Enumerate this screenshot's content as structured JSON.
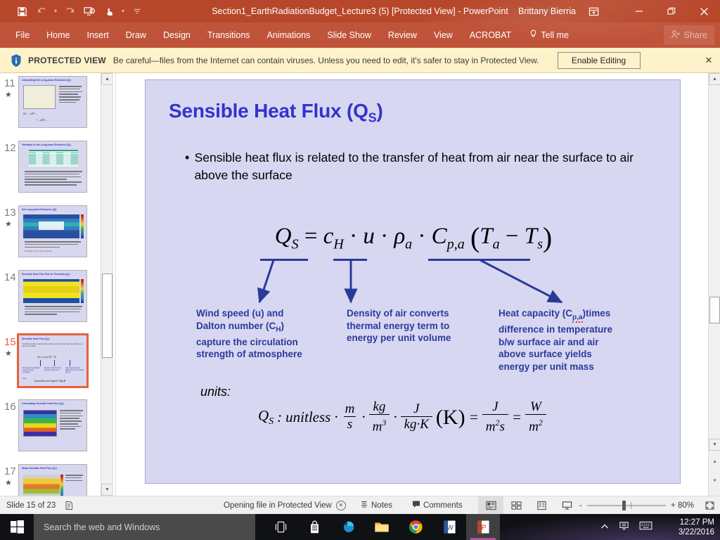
{
  "titlebar": {
    "document_title": "Section1_EarthRadiationBudget_Lecture3 (5) [Protected View] - PowerPoint",
    "user_name": "Brittany Bierria",
    "qat": [
      {
        "name": "save-icon",
        "label": "Save"
      },
      {
        "name": "undo-icon",
        "label": "Undo"
      },
      {
        "name": "redo-icon",
        "label": "Redo"
      },
      {
        "name": "start-from-beginning-icon",
        "label": "Start From Beginning"
      },
      {
        "name": "touch-mouse-mode-icon",
        "label": "Touch/Mouse Mode"
      },
      {
        "name": "customize-quick-access-toolbar-icon",
        "label": "Customize Quick Access Toolbar"
      }
    ],
    "window_controls": [
      {
        "name": "ribbon-display-options-icon",
        "glyph": "⤒"
      },
      {
        "name": "minimize-button",
        "glyph": "—"
      },
      {
        "name": "restore-button",
        "glyph": "❐"
      },
      {
        "name": "close-button",
        "glyph": "✕"
      }
    ]
  },
  "ribbon": {
    "tabs": [
      "File",
      "Home",
      "Insert",
      "Draw",
      "Design",
      "Transitions",
      "Animations",
      "Slide Show",
      "Review",
      "View",
      "ACROBAT"
    ],
    "tell_me": "Tell me",
    "share": "Share"
  },
  "protected_view": {
    "label": "PROTECTED VIEW",
    "message": "Be careful—files from the Internet can contain viruses. Unless you need to edit, it's safer to stay in Protected View.",
    "button": "Enable Editing",
    "close": "✕",
    "bar_color": "#fdf2ca"
  },
  "thumbnails": [
    {
      "number": "11",
      "title": "Calculating Net Long-wave Emission (Qₗ)",
      "starred": true,
      "selected": false,
      "kind": "chart"
    },
    {
      "number": "12",
      "title": "Variation in Net Long-wave Emission (Qₗ)",
      "starred": false,
      "selected": false,
      "kind": "table"
    },
    {
      "number": "13",
      "title": "Net Long-wave Emission (Qₗ)",
      "starred": true,
      "selected": false,
      "kind": "map-blue"
    },
    {
      "number": "14",
      "title": "Sensible Heat Flux Due to Thermals (Qₛ)",
      "starred": false,
      "selected": false,
      "kind": "map-yellow"
    },
    {
      "number": "15",
      "title": "Sensible Heat Flux (Qₛ)",
      "starred": true,
      "selected": true,
      "kind": "equation"
    },
    {
      "number": "16",
      "title": "Calculating Sensible Heat Flux (Qₛ)",
      "starred": false,
      "selected": false,
      "kind": "map-rainbow"
    },
    {
      "number": "17",
      "title": "Mean Sensible Heat Flux (Qₛ)",
      "starred": true,
      "selected": false,
      "kind": "map-grey"
    }
  ],
  "slide": {
    "background_color": "#d7d7f2",
    "title_color": "#3333cc",
    "title_main": "Sensible Heat Flux (Q",
    "title_sub": "S",
    "title_close": ")",
    "bullet": "Sensible heat flux is related to the transfer of heat from air near the surface to air above the surface",
    "equation": {
      "lhs": "Q",
      "lhs_sub": "S",
      "eq": " = ",
      "terms": "cₕ · u · ρₐ · Cₚ,ₐ (Tₐ − Tₛ)",
      "parts": {
        "c": "c",
        "c_sub": "H",
        "u": "u",
        "rho": "ρ",
        "rho_sub": "a",
        "C": "C",
        "C_sub": "p,a",
        "Ta": "T",
        "Ta_sub": "a",
        "Ts": "T",
        "Ts_sub": "s",
        "minus": "−",
        "dot": "·"
      }
    },
    "annotations": [
      {
        "id": "wind-speed-annotation",
        "line1": "Wind speed (u) and",
        "line2": "Dalton number (C",
        "line2_sub": "H",
        "line2_end": ")",
        "line3": "capture the circulation",
        "line4": "strength of atmosphere"
      },
      {
        "id": "density-annotation",
        "line1": "Density of air converts",
        "line2": "thermal energy term to",
        "line3": "energy per unit volume"
      },
      {
        "id": "heat-capacity-annotation",
        "line1_a": "Heat capacity (C",
        "line1_sub": "p,a",
        "line1_b": ")times",
        "line2": "difference in temperature",
        "line3": "b/w surface air and air",
        "line4": "above surface yields",
        "line5": "energy per unit mass"
      }
    ],
    "units_label": "units:",
    "units_equation": {
      "lhs": "Q",
      "lhs_sub": "S",
      "colon": " : ",
      "unitless": "unitless",
      "dot": "·",
      "f1_num": "m",
      "f1_den": "s",
      "f2_num": "kg",
      "f2_den": "m",
      "f2_den_sup": "3",
      "f3_num": "J",
      "f3_den": "kg·K",
      "kelvin": "(K)",
      "equals": "=",
      "f4_num": "J",
      "f4_den_a": "m",
      "f4_den_sup": "2",
      "f4_den_b": "s",
      "equals2": "=",
      "f5_num": "W",
      "f5_den": "m",
      "f5_den_sup": "2"
    },
    "annotation_color": "#2b3a99"
  },
  "statusbar": {
    "slide_count": "Slide 15 of 23",
    "message": "Opening file in Protected View",
    "notes": "Notes",
    "comments": "Comments",
    "views": [
      {
        "name": "normal-view-button",
        "active": true
      },
      {
        "name": "slide-sorter-view-button",
        "active": false
      },
      {
        "name": "reading-view-button",
        "active": false
      },
      {
        "name": "slide-show-button",
        "active": false
      }
    ],
    "zoom_out": "-",
    "zoom_in": "+",
    "zoom_level": "80%"
  },
  "taskbar": {
    "search_placeholder": "Search the web and Windows",
    "icons": [
      {
        "name": "task-view-icon",
        "active": false
      },
      {
        "name": "store-icon",
        "active": false
      },
      {
        "name": "edge-icon",
        "active": false
      },
      {
        "name": "file-explorer-icon",
        "active": false
      },
      {
        "name": "chrome-icon",
        "active": false
      },
      {
        "name": "word-icon",
        "active": false
      },
      {
        "name": "powerpoint-icon",
        "active": true
      }
    ],
    "tray": [
      {
        "name": "show-hidden-icons-icon",
        "glyph": "⌃"
      },
      {
        "name": "onedrive-icon",
        "glyph": ""
      },
      {
        "name": "keyboard-icon",
        "glyph": ""
      }
    ],
    "time": "12:27 PM",
    "date": "3/22/2016"
  }
}
